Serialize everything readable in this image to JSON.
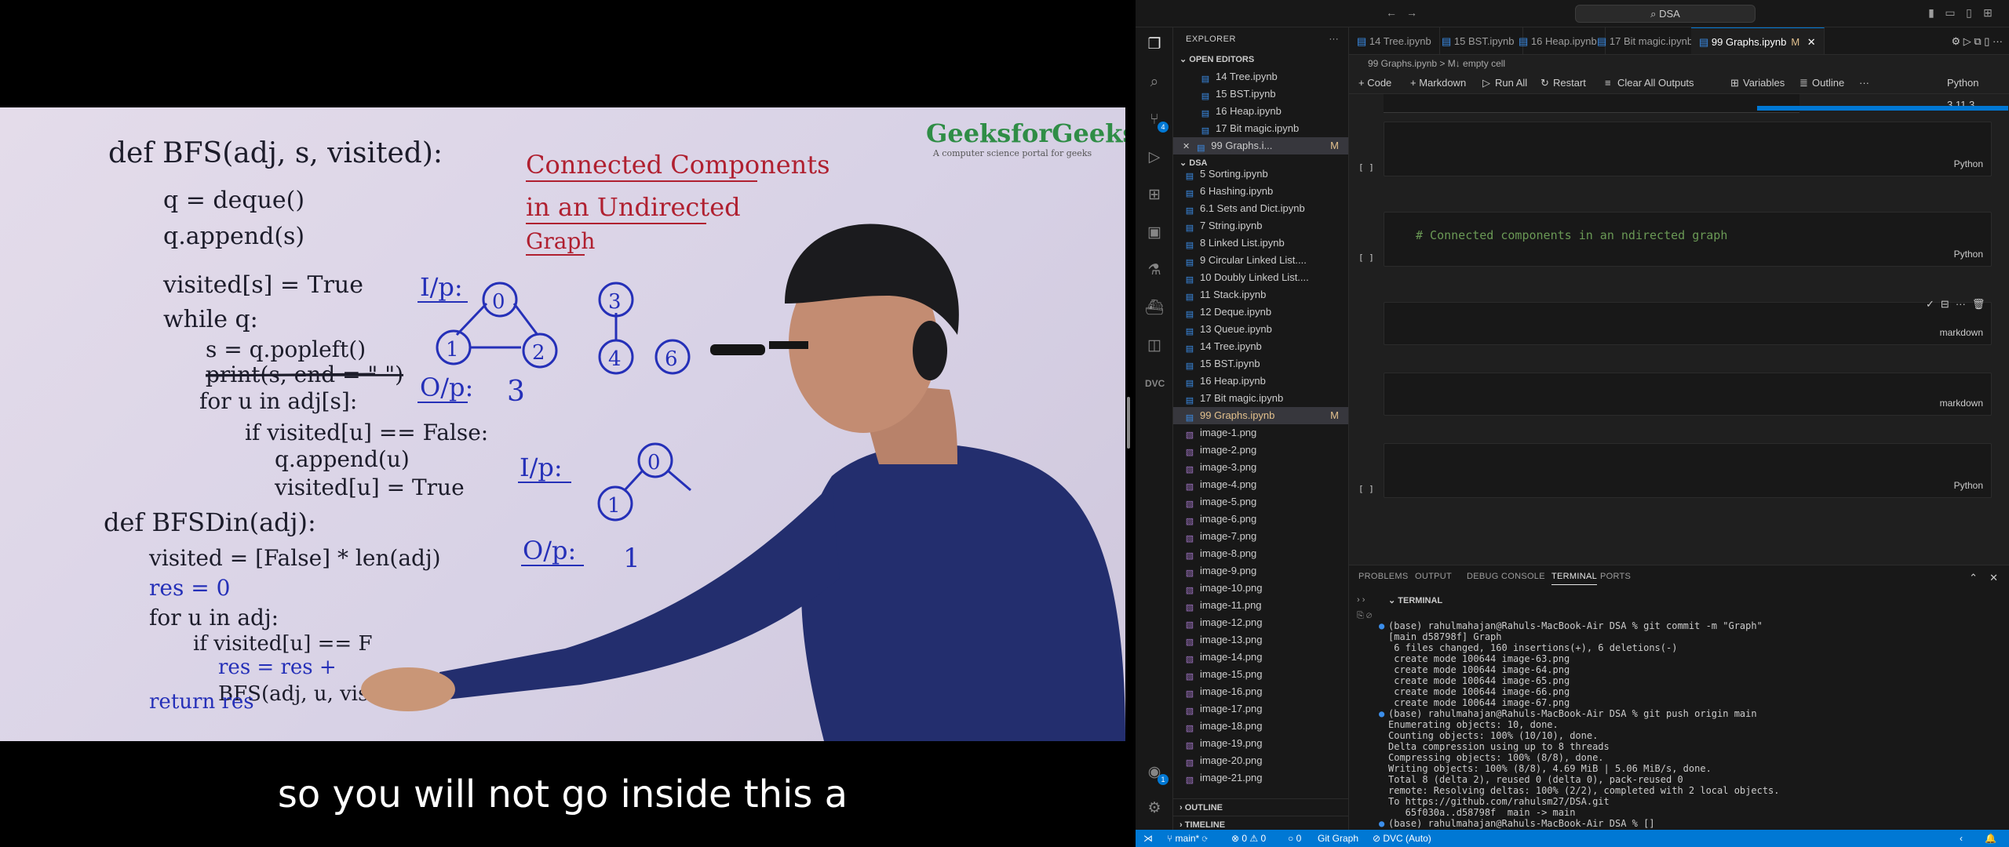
{
  "video": {
    "logo_title": "GeeksforGeeks",
    "logo_tagline": "A computer science portal for geeks",
    "board_title": [
      "Connected Components",
      "in an Undirected",
      "Graph"
    ],
    "code_lines": [
      "def BFS(adj, s, visited):",
      "q = deque()",
      "q.append(s)",
      "visited[s] = True",
      "while q:",
      "s = q.popleft()",
      "print(s, end = \" \")",
      "for u in adj[s]:",
      "if visited[u] == False:",
      "q.append(u)",
      "visited[u] = True",
      "def BFSDin(adj):",
      "visited = [False] * len(adj)",
      "res = 0",
      "for u in adj:",
      "if visited[u] == F",
      "res = res +",
      "BFS(adj, u, visited)",
      "return res"
    ],
    "ip_label": "I/p:",
    "op_label": "O/p:",
    "op_value": "3",
    "op_value2": "1",
    "graph_nodes": [
      "0",
      "1",
      "2",
      "3",
      "4",
      "6",
      "0",
      "1"
    ],
    "subtitle": "so you will not go inside this a"
  },
  "vscode": {
    "search": "DSA",
    "explorer_title": "EXPLORER",
    "open_editors_label": "OPEN EDITORS",
    "open_editors": [
      {
        "name": "14 Tree.ipynb",
        "mod": ""
      },
      {
        "name": "15 BST.ipynb",
        "mod": ""
      },
      {
        "name": "16 Heap.ipynb",
        "mod": ""
      },
      {
        "name": "17 Bit magic.ipynb",
        "mod": ""
      },
      {
        "name": "99 Graphs.i...",
        "mod": "M"
      }
    ],
    "folder_label": "DSA",
    "files": [
      {
        "name": "5 Sorting.ipynb",
        "kind": "nb",
        "mod": ""
      },
      {
        "name": "6 Hashing.ipynb",
        "kind": "nb",
        "mod": ""
      },
      {
        "name": "6.1 Sets and Dict.ipynb",
        "kind": "nb",
        "mod": ""
      },
      {
        "name": "7 String.ipynb",
        "kind": "nb",
        "mod": ""
      },
      {
        "name": "8 Linked List.ipynb",
        "kind": "nb",
        "mod": ""
      },
      {
        "name": "9 Circular Linked List....",
        "kind": "nb",
        "mod": ""
      },
      {
        "name": "10 Doubly Linked List....",
        "kind": "nb",
        "mod": ""
      },
      {
        "name": "11 Stack.ipynb",
        "kind": "nb",
        "mod": ""
      },
      {
        "name": "12 Deque.ipynb",
        "kind": "nb",
        "mod": ""
      },
      {
        "name": "13 Queue.ipynb",
        "kind": "nb",
        "mod": ""
      },
      {
        "name": "14 Tree.ipynb",
        "kind": "nb",
        "mod": ""
      },
      {
        "name": "15 BST.ipynb",
        "kind": "nb",
        "mod": ""
      },
      {
        "name": "16 Heap.ipynb",
        "kind": "nb",
        "mod": ""
      },
      {
        "name": "17 Bit magic.ipynb",
        "kind": "nb",
        "mod": ""
      },
      {
        "name": "99 Graphs.ipynb",
        "kind": "nb",
        "mod": "M"
      },
      {
        "name": "image-1.png",
        "kind": "img",
        "mod": ""
      },
      {
        "name": "image-2.png",
        "kind": "img",
        "mod": ""
      },
      {
        "name": "image-3.png",
        "kind": "img",
        "mod": ""
      },
      {
        "name": "image-4.png",
        "kind": "img",
        "mod": ""
      },
      {
        "name": "image-5.png",
        "kind": "img",
        "mod": ""
      },
      {
        "name": "image-6.png",
        "kind": "img",
        "mod": ""
      },
      {
        "name": "image-7.png",
        "kind": "img",
        "mod": ""
      },
      {
        "name": "image-8.png",
        "kind": "img",
        "mod": ""
      },
      {
        "name": "image-9.png",
        "kind": "img",
        "mod": ""
      },
      {
        "name": "image-10.png",
        "kind": "img",
        "mod": ""
      },
      {
        "name": "image-11.png",
        "kind": "img",
        "mod": ""
      },
      {
        "name": "image-12.png",
        "kind": "img",
        "mod": ""
      },
      {
        "name": "image-13.png",
        "kind": "img",
        "mod": ""
      },
      {
        "name": "image-14.png",
        "kind": "img",
        "mod": ""
      },
      {
        "name": "image-15.png",
        "kind": "img",
        "mod": ""
      },
      {
        "name": "image-16.png",
        "kind": "img",
        "mod": ""
      },
      {
        "name": "image-17.png",
        "kind": "img",
        "mod": ""
      },
      {
        "name": "image-18.png",
        "kind": "img",
        "mod": ""
      },
      {
        "name": "image-19.png",
        "kind": "img",
        "mod": ""
      },
      {
        "name": "image-20.png",
        "kind": "img",
        "mod": ""
      },
      {
        "name": "image-21.png",
        "kind": "img",
        "mod": ""
      }
    ],
    "outline_label": "OUTLINE",
    "timeline_label": "TIMELINE",
    "tabs": [
      {
        "label": "14 Tree.ipynb",
        "active": false
      },
      {
        "label": "15 BST.ipynb",
        "active": false
      },
      {
        "label": "16 Heap.ipynb",
        "active": false
      },
      {
        "label": "17 Bit magic.ipynb",
        "active": false
      },
      {
        "label": "99 Graphs.ipynb",
        "active": true
      }
    ],
    "active_tab_mod": "M",
    "breadcrumb": "99 Graphs.ipynb  >  M↓ empty cell",
    "toolbar": {
      "code": "+ Code",
      "markdown": "+ Markdown",
      "run_all": "Run All",
      "restart": "Restart",
      "clear": "Clear All Outputs",
      "variables": "Variables",
      "outline": "Outline",
      "more": "···",
      "kernel": "Python 3.11.3"
    },
    "cells": [
      {
        "lang": "Python",
        "text": ""
      },
      {
        "lang": "Python",
        "text": "# Connected components in an ndirected graph"
      },
      {
        "lang": "markdown",
        "text": ""
      },
      {
        "lang": "markdown",
        "text": ""
      },
      {
        "lang": "Python",
        "text": ""
      }
    ],
    "cell_bracket": "[ ]",
    "panel_tabs": [
      {
        "label": "PROBLEMS",
        "active": false
      },
      {
        "label": "OUTPUT",
        "active": false
      },
      {
        "label": "DEBUG CONSOLE",
        "active": false
      },
      {
        "label": "TERMINAL",
        "active": true
      },
      {
        "label": "PORTS",
        "active": false
      }
    ],
    "terminal_label": "TERMINAL",
    "terminal_lines": [
      {
        "text": "(base) rahulmahajan@Rahuls-MacBook-Air DSA % git commit -m \"Graph\"",
        "bullet": true
      },
      {
        "text": "[main d58798f] Graph",
        "bullet": false
      },
      {
        "text": " 6 files changed, 160 insertions(+), 6 deletions(-)",
        "bullet": false
      },
      {
        "text": " create mode 100644 image-63.png",
        "bullet": false
      },
      {
        "text": " create mode 100644 image-64.png",
        "bullet": false
      },
      {
        "text": " create mode 100644 image-65.png",
        "bullet": false
      },
      {
        "text": " create mode 100644 image-66.png",
        "bullet": false
      },
      {
        "text": " create mode 100644 image-67.png",
        "bullet": false
      },
      {
        "text": "(base) rahulmahajan@Rahuls-MacBook-Air DSA % git push origin main",
        "bullet": true
      },
      {
        "text": "Enumerating objects: 10, done.",
        "bullet": false
      },
      {
        "text": "Counting objects: 100% (10/10), done.",
        "bullet": false
      },
      {
        "text": "Delta compression using up to 8 threads",
        "bullet": false
      },
      {
        "text": "Compressing objects: 100% (8/8), done.",
        "bullet": false
      },
      {
        "text": "Writing objects: 100% (8/8), 4.69 MiB | 5.06 MiB/s, done.",
        "bullet": false
      },
      {
        "text": "Total 8 (delta 2), reused 0 (delta 0), pack-reused 0",
        "bullet": false
      },
      {
        "text": "remote: Resolving deltas: 100% (2/2), completed with 2 local objects.",
        "bullet": false
      },
      {
        "text": "To https://github.com/rahulsm27/DSA.git",
        "bullet": false
      },
      {
        "text": "   65f030a..d58798f  main -> main",
        "bullet": false
      },
      {
        "text": "(base) rahulmahajan@Rahuls-MacBook-Air DSA % []",
        "bullet": true
      }
    ],
    "status": {
      "branch": "main*",
      "errors": "⊗ 0 ⚠ 0",
      "ports": "○ 0",
      "git_graph": "Git Graph",
      "dvc": "DVC (Auto)"
    },
    "badges": {
      "scm": "4",
      "account": "1"
    }
  }
}
